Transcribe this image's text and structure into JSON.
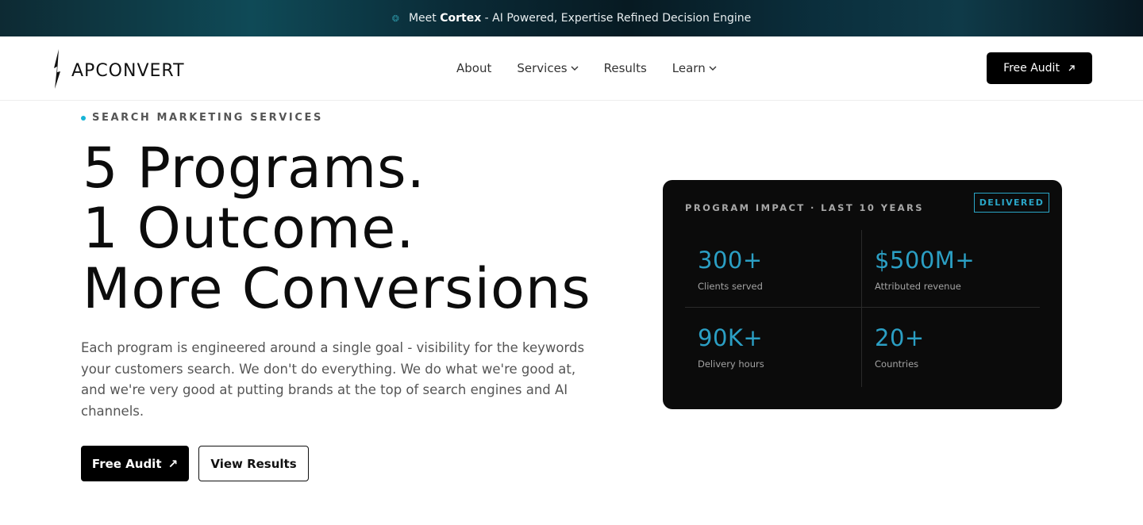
{
  "announcement": {
    "prefix": "Meet",
    "brand": "Cortex",
    "suffix": "- AI Powered, Expertise Refined Decision Engine"
  },
  "nav": {
    "logo_text": "APCONVERT",
    "items": [
      {
        "label": "About",
        "has_dropdown": false
      },
      {
        "label": "Services",
        "has_dropdown": true
      },
      {
        "label": "Results",
        "has_dropdown": false
      },
      {
        "label": "Learn",
        "has_dropdown": true
      }
    ],
    "cta_label": "Free Audit",
    "cta_icon": "arrow-up-right"
  },
  "hero": {
    "eyebrow": "SEARCH MARKETING SERVICES",
    "headline_lines": [
      "5 Programs.",
      "1 Outcome.",
      "More Conversions"
    ],
    "lead": "Each program is engineered around a single goal - visibility for the keywords your customers search. We don't do everything. We do what we're good at, and we're very good at putting brands at the top of search engines and AI channels.",
    "primary_cta": "Free Audit",
    "primary_cta_icon": "↗",
    "secondary_cta": "View Results"
  },
  "impact_card": {
    "title": "PROGRAM IMPACT · LAST 10 YEARS",
    "badge": "DELIVERED",
    "stats": [
      {
        "value": "300+",
        "label": "Clients served"
      },
      {
        "value": "$500M+",
        "label": "Attributed revenue"
      },
      {
        "value": "90K+",
        "label": "Delivery hours"
      },
      {
        "value": "20+",
        "label": "Countries"
      }
    ]
  },
  "colors": {
    "accent": "#2b9fc4",
    "eyebrow_dot": "#17b4d6",
    "card_bg": "#0b0b0b",
    "button_bg": "#000000"
  }
}
